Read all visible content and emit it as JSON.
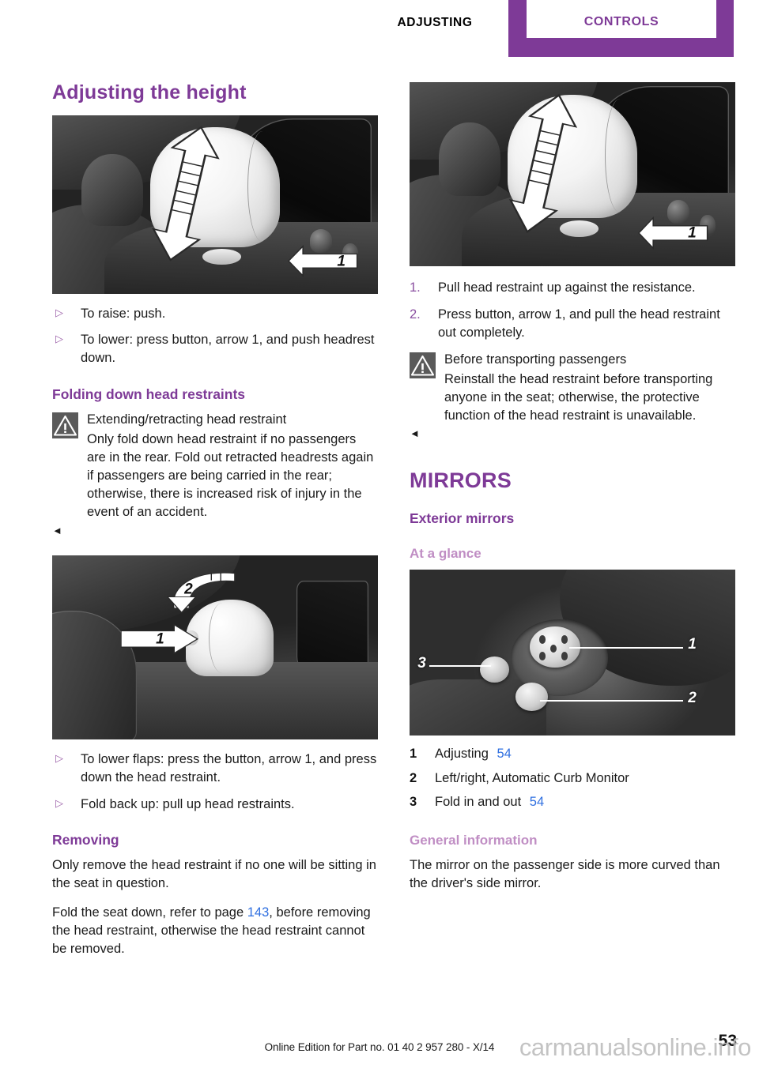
{
  "header": {
    "left_label": "ADJUSTING",
    "tab_label": "CONTROLS",
    "accent_color": "#7e3a97"
  },
  "left_column": {
    "heading_adjusting_height": "Adjusting the height",
    "figure_headrest_height": {
      "callout_1": "1",
      "alt": "Rear head restraint with up/down double arrow and release button callout 1"
    },
    "bullets_height": [
      {
        "marker": "▷",
        "text": "To raise: push."
      },
      {
        "marker": "▷",
        "text": "To lower: press button, arrow 1, and push headrest down."
      }
    ],
    "heading_folding_down": "Folding down head restraints",
    "warning_folding": {
      "icon": "warning-triangle-icon",
      "title": "Extending/retracting head restraint",
      "body": "Only fold down head restraint if no passengers are in the rear. Fold out retracted headrests again if passengers are being carried in the rear; otherwise, there is increased risk of injury in the event of an accident.",
      "end_mark": "◄"
    },
    "figure_folding": {
      "callout_1": "1",
      "callout_2": "2",
      "alt": "Head restraint with arrow 1 pointing at button and curved arrow 2 folding it down"
    },
    "bullets_folding": [
      {
        "marker": "▷",
        "text": "To lower flaps: press the button, arrow 1, and press down the head restraint."
      },
      {
        "marker": "▷",
        "text": "Fold back up: pull up head restraints."
      }
    ],
    "heading_removing": "Removing",
    "removing_para_1": "Only remove the head restraint if no one will be sitting in the seat in question.",
    "removing_para_2_before": "Fold the seat down, refer to page",
    "removing_page_ref": "143",
    "removing_para_2_after": ", before removing the head restraint, otherwise the head restraint cannot be removed."
  },
  "right_column": {
    "figure_headrest_pull": {
      "callout_1": "1",
      "alt": "Rear head restraint with up/down double arrow and release button callout 1"
    },
    "steps_removing": [
      {
        "number": "1.",
        "text": "Pull head restraint up against the resistance."
      },
      {
        "number": "2.",
        "text": "Press button, arrow 1, and pull the head restraint out completely."
      }
    ],
    "warning_transport": {
      "icon": "warning-triangle-icon",
      "title": "Before transporting passengers",
      "body": "Reinstall the head restraint before transporting anyone in the seat; otherwise, the protective function of the head restraint is unavailable.",
      "end_mark": "◄"
    },
    "heading_mirrors": "MIRRORS",
    "heading_exterior_mirrors": "Exterior mirrors",
    "heading_at_a_glance": "At a glance",
    "figure_mirror_controls": {
      "callout_1": "1",
      "callout_2": "2",
      "callout_3": "3",
      "alt": "Door panel mirror control joystick with three numbered callouts"
    },
    "legend": [
      {
        "number": "1",
        "label": "Adjusting",
        "page": "54"
      },
      {
        "number": "2",
        "label": "Left/right, Automatic Curb Monitor",
        "page": ""
      },
      {
        "number": "3",
        "label": "Fold in and out",
        "page": "54"
      }
    ],
    "heading_general_information": "General information",
    "general_info_para": "The mirror on the passenger side is more curved than the driver's side mirror."
  },
  "footer": {
    "edition_text": "Online Edition for Part no. 01 40 2 957 280 - X/14",
    "page_number": "53",
    "watermark": "carmanualsonline.info"
  }
}
